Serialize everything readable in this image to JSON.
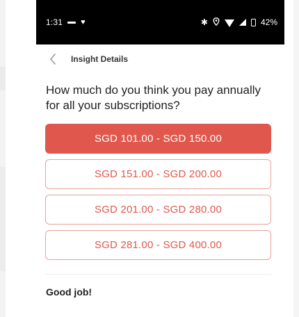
{
  "status_bar": {
    "time": "1:31",
    "battery": "42%",
    "icons": [
      "notification-dash-icon",
      "heart-icon",
      "bluetooth-icon",
      "location-icon",
      "wifi-icon",
      "signal-icon",
      "battery-icon"
    ]
  },
  "header": {
    "back_icon": "chevron-left-icon",
    "title": "Insight Details"
  },
  "question": "How much do you think you pay annually for all your subscriptions?",
  "options": [
    {
      "label": "SGD 101.00 - SGD 150.00",
      "selected": true
    },
    {
      "label": "SGD 151.00 - SGD 200.00",
      "selected": false
    },
    {
      "label": "SGD 201.00 - SGD 280.00",
      "selected": false
    },
    {
      "label": "SGD 281.00 - SGD 400.00",
      "selected": false
    }
  ],
  "feedback": "Good job!",
  "colors": {
    "accent": "#e0584d",
    "option_border": "#e7a29a",
    "status_bar": "#000000"
  }
}
